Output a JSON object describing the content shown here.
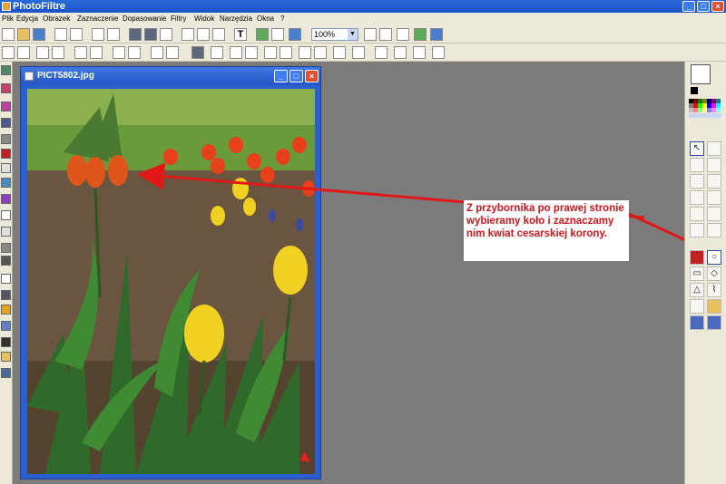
{
  "app": {
    "title": "PhotoFiltre",
    "window_controls": [
      "_",
      "□",
      "×"
    ]
  },
  "menu": {
    "items": [
      "Plik",
      "Edycja",
      "Obrazek",
      "Zaznaczenie",
      "Dopasowanie",
      "Filtry",
      "Widok",
      "Narzędzia",
      "Okna",
      "?"
    ]
  },
  "toolbar": {
    "zoom_value": "100%",
    "text_tool_glyph": "T"
  },
  "document": {
    "title": "PICT5802.jpg",
    "controls": [
      "_",
      "□",
      "×"
    ]
  },
  "annotation": {
    "text": "Z przybornika po prawej stronie wybieramy koło i zaznaczamy nim kwiat cesarskiej korony.",
    "color": "#d4141a"
  },
  "tools": {
    "pointer": "↖",
    "ellipse": "○",
    "rectangle": "▭",
    "diamond": "◇",
    "triangle": "△",
    "lasso": "⌇"
  }
}
